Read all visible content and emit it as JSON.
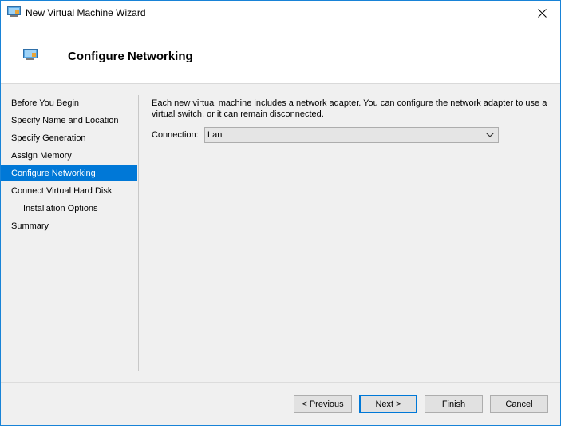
{
  "window": {
    "title": "New Virtual Machine Wizard",
    "icon": "virtual-machine-icon",
    "accent_color": "#0078d7"
  },
  "header": {
    "title": "Configure Networking",
    "icon": "virtual-machine-icon"
  },
  "sidebar": {
    "items": [
      {
        "label": "Before You Begin",
        "active": false,
        "indent": false
      },
      {
        "label": "Specify Name and Location",
        "active": false,
        "indent": false
      },
      {
        "label": "Specify Generation",
        "active": false,
        "indent": false
      },
      {
        "label": "Assign Memory",
        "active": false,
        "indent": false
      },
      {
        "label": "Configure Networking",
        "active": true,
        "indent": false
      },
      {
        "label": "Connect Virtual Hard Disk",
        "active": false,
        "indent": false
      },
      {
        "label": "Installation Options",
        "active": false,
        "indent": true
      },
      {
        "label": "Summary",
        "active": false,
        "indent": false
      }
    ]
  },
  "main": {
    "description": "Each new virtual machine includes a network adapter. You can configure the network adapter to use a virtual switch, or it can remain disconnected.",
    "connection": {
      "label": "Connection:",
      "value": "Lan"
    }
  },
  "footer": {
    "previous_label": "< Previous",
    "next_label": "Next >",
    "finish_label": "Finish",
    "cancel_label": "Cancel"
  }
}
